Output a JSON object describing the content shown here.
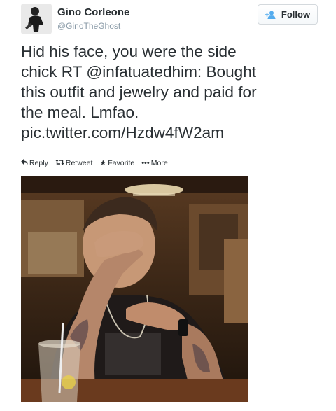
{
  "user": {
    "name": "Gino Corleone",
    "handle": "@GinoTheGhost",
    "avatar_icon": "profile-avatar-silhouette"
  },
  "follow_button": {
    "label": "Follow",
    "icon": "add-user-icon",
    "color": "#55acee"
  },
  "tweet": {
    "text": "Hid his face, you were the side\nchick RT @infatuatedhim: Bought\nthis outfit and jewelry and paid for\nthe meal. Lmfao.\npic.twitter.com/Hzdw4fW2am"
  },
  "actions": [
    {
      "label": "Reply",
      "icon": "reply-icon"
    },
    {
      "label": "Retweet",
      "icon": "retweet-icon"
    },
    {
      "label": "Favorite",
      "icon": "star-icon"
    },
    {
      "label": "More",
      "icon": "more-dots-icon"
    }
  ],
  "media": {
    "subject": "man-covering-face-photo"
  }
}
